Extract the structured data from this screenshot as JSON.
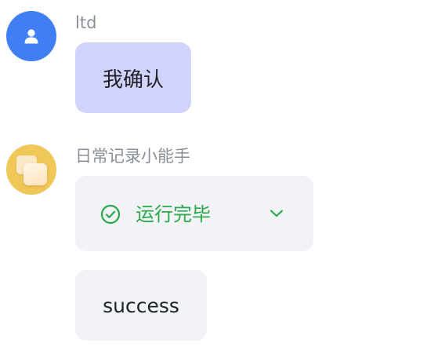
{
  "messages": [
    {
      "sender": "ltd",
      "avatar_icon": "user-icon",
      "avatar_color": "#3f7ff3",
      "bubble_text": "我确认",
      "bubble_color": "#d2d3fc"
    },
    {
      "sender": "日常记录小能手",
      "avatar_icon": "bot-avatar-icon",
      "avatar_color": "#f0c85a",
      "status": {
        "icon": "check-circle-icon",
        "text": "运行完毕",
        "color": "#29a94a",
        "toggle_icon": "chevron-down-icon"
      },
      "bubble_text": "success",
      "bubble_color": "#f2f3f6"
    }
  ]
}
